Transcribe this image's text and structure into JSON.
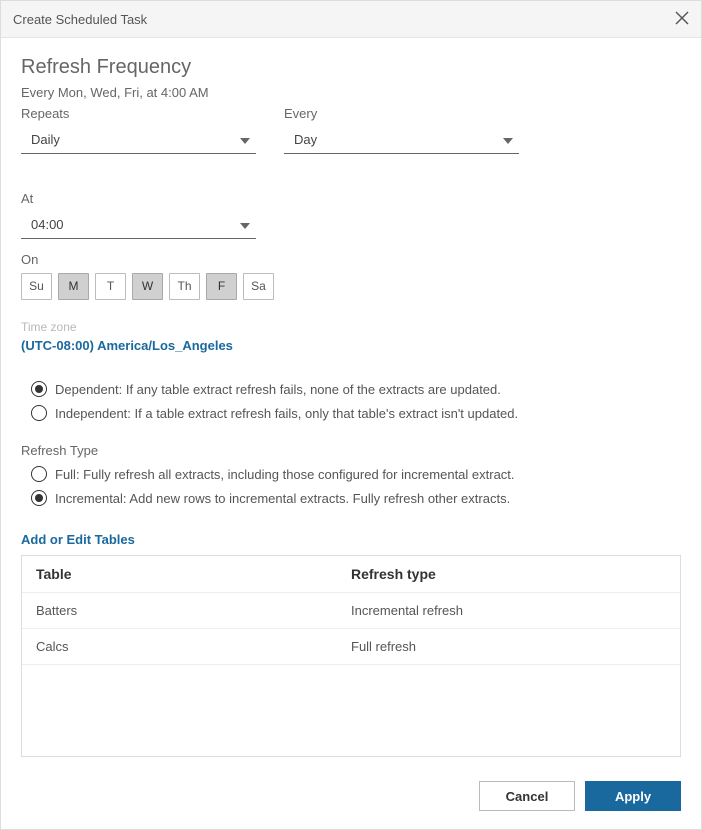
{
  "dialog": {
    "title": "Create Scheduled Task"
  },
  "frequency": {
    "heading": "Refresh Frequency",
    "summary": "Every Mon, Wed, Fri, at 4:00 AM",
    "repeats_label": "Repeats",
    "repeats_value": "Daily",
    "every_label": "Every",
    "every_value": "Day",
    "at_label": "At",
    "at_value": "04:00",
    "on_label": "On",
    "days": [
      {
        "abbr": "Su",
        "selected": false
      },
      {
        "abbr": "M",
        "selected": true
      },
      {
        "abbr": "T",
        "selected": false
      },
      {
        "abbr": "W",
        "selected": true
      },
      {
        "abbr": "Th",
        "selected": false
      },
      {
        "abbr": "F",
        "selected": true
      },
      {
        "abbr": "Sa",
        "selected": false
      }
    ],
    "timezone_label": "Time zone",
    "timezone_value": "(UTC-08:00) America/Los_Angeles"
  },
  "dependency": {
    "dependent": "Dependent: If any table extract refresh fails, none of the extracts are updated.",
    "independent": "Independent: If a table extract refresh fails, only that table's extract isn't updated.",
    "selected": "dependent"
  },
  "refresh_type": {
    "label": "Refresh Type",
    "full": "Full: Fully refresh all extracts, including those configured for incremental extract.",
    "incremental": "Incremental: Add new rows to incremental extracts. Fully refresh other extracts.",
    "selected": "incremental"
  },
  "tables": {
    "link": "Add or Edit Tables",
    "headers": {
      "table": "Table",
      "refresh_type": "Refresh type"
    },
    "rows": [
      {
        "table": "Batters",
        "refresh_type": "Incremental refresh"
      },
      {
        "table": "Calcs",
        "refresh_type": "Full refresh"
      }
    ]
  },
  "buttons": {
    "cancel": "Cancel",
    "apply": "Apply"
  }
}
